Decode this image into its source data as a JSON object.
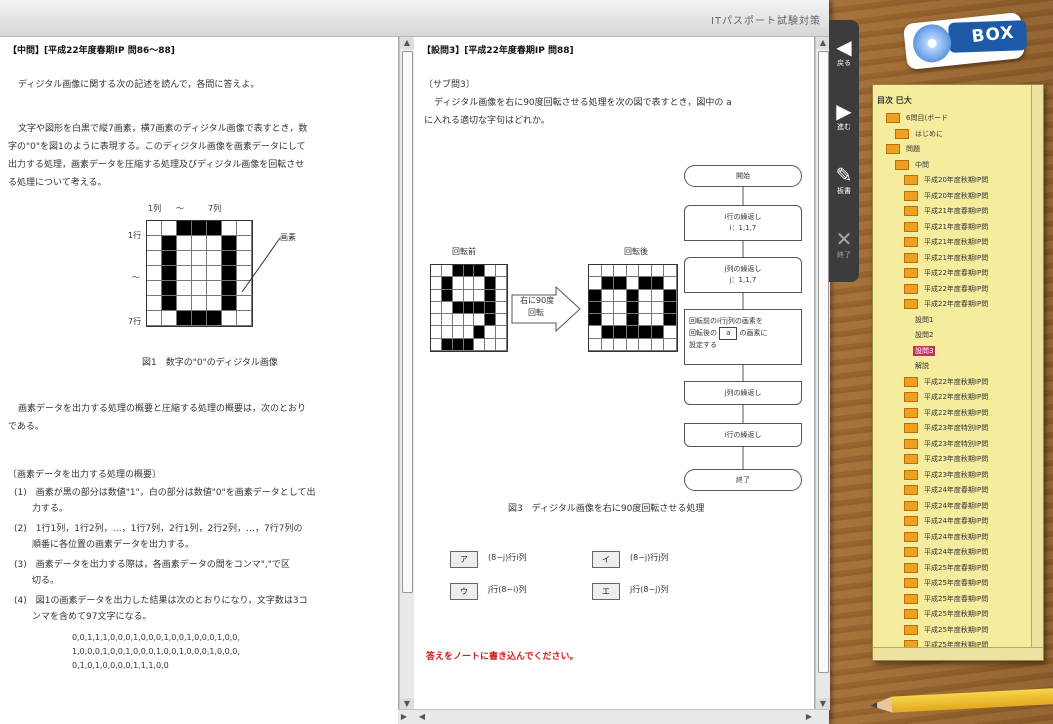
{
  "window": {
    "title": "ITパスポート試験対策"
  },
  "left_pane": {
    "heading": "【中問】[平成22年度春期IP 問86〜88]",
    "intro": "ディジタル画像に関する次の記述を読んで，各問に答えよ。",
    "para": [
      "文字や図形を白黒で縦7画素，横7画素のディジタル画像で表すとき，数",
      "字の\"0\"を図1のように表現する。このディジタル画像を画素データにして",
      "出力する処理，画素データを圧縮する処理及びディジタル画像を回転させ",
      "る処理について考える。"
    ],
    "fig_axis_top": [
      "1列",
      "〜",
      "7列"
    ],
    "fig_axis_left": [
      "1行",
      "〜",
      "7行"
    ],
    "fig_pointer": "画素",
    "fig_caption": "図1　数字の\"0\"のディジタル画像",
    "para2": [
      "画素データを出力する処理の概要と圧縮する処理の概要は，次のとおり",
      "である。"
    ],
    "section": "〔画素データを出力する処理の概要〕",
    "items": [
      "(1)　画素が黒の部分は数値\"1\"，白の部分は数値\"0\"を画素データとして出",
      "　　力する。",
      "(2)　1行1列，1行2列，…，1行7列，2行1列，2行2列，…，7行7列の",
      "　　順番に各位置の画素データを出力する。",
      "(3)　画素データを出力する際は，各画素データの間をコンマ\",\"で区",
      "　　切る。",
      "(4)　図1の画素データを出力した結果は次のとおりになり，文字数は3コ",
      "　　ンマを含めて97文字になる。"
    ],
    "data_lines": [
      "0,0,1,1,1,0,0,0,1,0,0,0,1,0,0,1,0,0,0,1,0,0,",
      "1,0,0,0,1,0,0,1,0,0,0,1,0,0,1,0,0,0,1,0,0,0,",
      "0,1,0,1,0,0,0,0,1,1,1,0,0"
    ]
  },
  "right_pane": {
    "heading": "【設問3】[平成22年度春期IP 問88]",
    "sub": "〔サブ問3〕",
    "question": [
      "ディジタル画像を右に90度回転させる処理を次の図で表すとき，図中の a",
      "に入れる適切な字句はどれか。"
    ],
    "before_label": "回転前",
    "after_label": "回転後",
    "arrow_label": [
      "右に90度",
      "回転"
    ],
    "flow": {
      "start": "開始",
      "loop1_top": [
        "i行の繰返し",
        "i：1,1,7"
      ],
      "loop2_top": [
        "j列の繰返し",
        "j：1,1,7"
      ],
      "process": [
        "回転前のi行j列の画素を",
        "回転後の",
        "a",
        "の画素に",
        "設定する"
      ],
      "loop2_end": "j列の繰返し",
      "loop1_end": "i行の繰返し",
      "end": "終了"
    },
    "fig_caption": "図3　ディジタル画像を右に90度回転させる処理",
    "choices": [
      {
        "key": "ア",
        "text": "(8−j)行i列"
      },
      {
        "key": "イ",
        "text": "(8−j)行j列"
      },
      {
        "key": "ウ",
        "text": "j行(8−i)列"
      },
      {
        "key": "エ",
        "text": "j行(8−j)列"
      }
    ],
    "notice": "答えをノートに書き込んでください。"
  },
  "sidenav": [
    {
      "icon": "◀",
      "label": "戻る"
    },
    {
      "icon": "▶",
      "label": "進む"
    },
    {
      "icon": "✎",
      "label": "板書"
    },
    {
      "icon": "✕",
      "label": "終了"
    }
  ],
  "logo": {
    "text": "BOX"
  },
  "tree": {
    "root": "目次 巳大",
    "rows": [
      {
        "indent": 1,
        "label": "6問目(ボード"
      },
      {
        "indent": 2,
        "label": "はじめに"
      },
      {
        "indent": 1,
        "label": "問題"
      },
      {
        "indent": 2,
        "label": "中問"
      },
      {
        "indent": 3,
        "label": "平成20年度秋期IP問"
      },
      {
        "indent": 3,
        "label": "平成20年度秋期IP問"
      },
      {
        "indent": 3,
        "label": "平成21年度春期IP問"
      },
      {
        "indent": 3,
        "label": "平成21年度春期IP問"
      },
      {
        "indent": 3,
        "label": "平成21年度秋期IP問"
      },
      {
        "indent": 3,
        "label": "平成21年度秋期IP問"
      },
      {
        "indent": 3,
        "label": "平成22年度春期IP問"
      },
      {
        "indent": 3,
        "label": "平成22年度春期IP問"
      },
      {
        "indent": 3,
        "label": "平成22年度春期IP問"
      },
      {
        "indent": 4,
        "label": "設問1",
        "plain": true
      },
      {
        "indent": 4,
        "label": "設問2",
        "plain": true
      },
      {
        "indent": 4,
        "label": "設問3",
        "plain": true,
        "selected": true
      },
      {
        "indent": 4,
        "label": "解説",
        "plain": true
      },
      {
        "indent": 3,
        "label": "平成22年度秋期IP問"
      },
      {
        "indent": 3,
        "label": "平成22年度秋期IP問"
      },
      {
        "indent": 3,
        "label": "平成22年度秋期IP問"
      },
      {
        "indent": 3,
        "label": "平成23年度特別IP問"
      },
      {
        "indent": 3,
        "label": "平成23年度特別IP問"
      },
      {
        "indent": 3,
        "label": "平成23年度秋期IP問"
      },
      {
        "indent": 3,
        "label": "平成23年度秋期IP問"
      },
      {
        "indent": 3,
        "label": "平成24年度春期IP問"
      },
      {
        "indent": 3,
        "label": "平成24年度春期IP問"
      },
      {
        "indent": 3,
        "label": "平成24年度春期IP問"
      },
      {
        "indent": 3,
        "label": "平成24年度秋期IP問"
      },
      {
        "indent": 3,
        "label": "平成24年度秋期IP問"
      },
      {
        "indent": 3,
        "label": "平成25年度春期IP問"
      },
      {
        "indent": 3,
        "label": "平成25年度春期IP問"
      },
      {
        "indent": 3,
        "label": "平成25年度春期IP問"
      },
      {
        "indent": 3,
        "label": "平成25年度秋期IP問"
      },
      {
        "indent": 3,
        "label": "平成25年度秋期IP問"
      },
      {
        "indent": 3,
        "label": "平成25年度秋期IP問"
      }
    ]
  },
  "pixel_grids": {
    "zero": [
      "0011100",
      "0100010",
      "0100010",
      "0100010",
      "0100010",
      "0100010",
      "0011100"
    ],
    "nine": [
      "0011100",
      "0100010",
      "0100010",
      "0011110",
      "0000010",
      "0000100",
      "0111000"
    ],
    "rotated": [
      "0000000",
      "0110110",
      "1001001",
      "1001001",
      "1001001",
      "0111110",
      "0000000"
    ]
  },
  "colors": {
    "accent_red": "#d21a1a",
    "tree_bg": "#f5ec9e",
    "folder": "#f0a020",
    "selected": "#c03060",
    "logo_blue": "#1d5aa8"
  }
}
